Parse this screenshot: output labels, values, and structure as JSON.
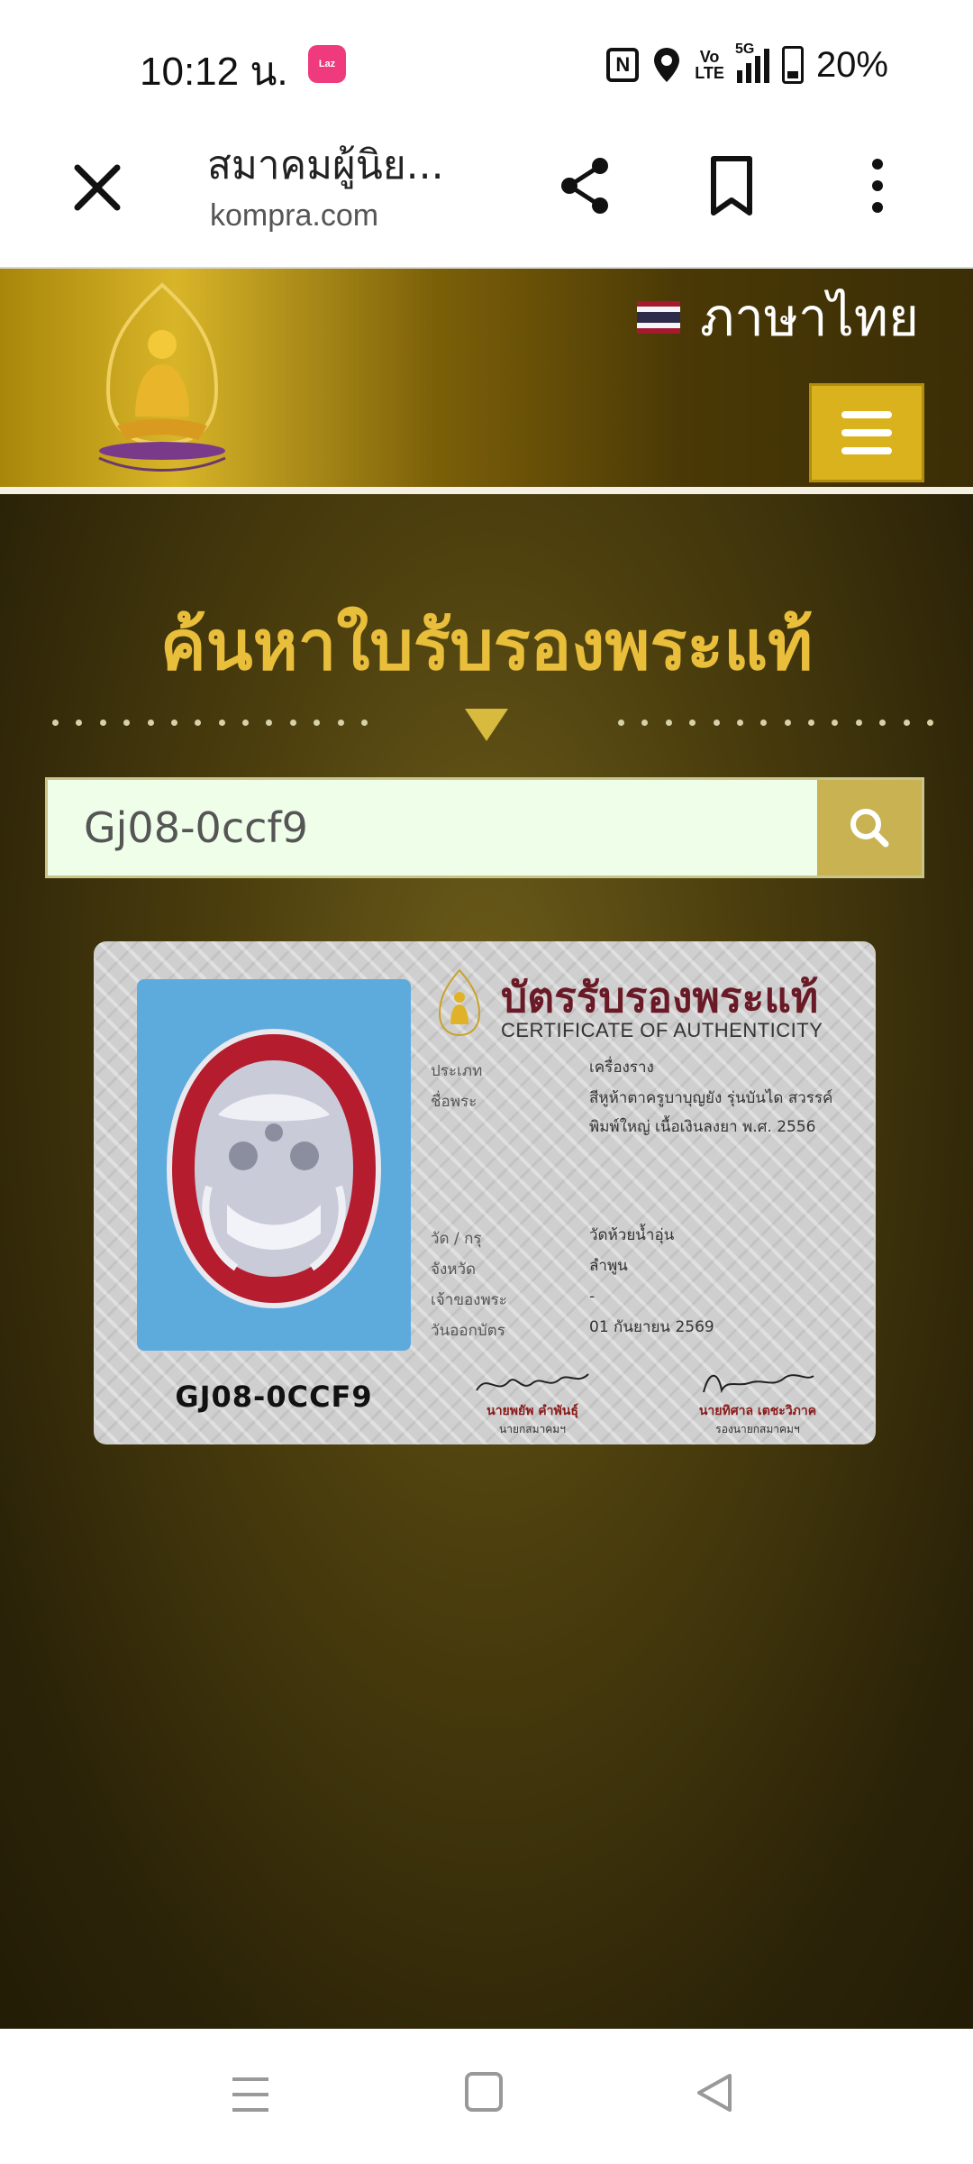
{
  "status_bar": {
    "time": "10:12 น.",
    "laz_label": "Laz",
    "nfc_label": "N",
    "volte_label": "Vo\nLTE",
    "network_label": "5G",
    "battery": "20%"
  },
  "browser": {
    "title": "สมาคมผู้นิย...",
    "url": "kompra.com",
    "icons": [
      "close-icon",
      "share-icon",
      "bookmark-icon",
      "more-vert-icon"
    ]
  },
  "site_header": {
    "language_label": "ภาษาไทย",
    "flag_colors": [
      "#A51931",
      "#F4F5F8",
      "#2D2A4A",
      "#F4F5F8",
      "#A51931"
    ],
    "menu_icon": "hamburger-icon"
  },
  "search": {
    "heading": "ค้นหาใบรับรองพระแท้",
    "query": "Gj08-0ccf9",
    "button_icon": "search-icon"
  },
  "certificate": {
    "title_th": "บัตรรับรองพระแท้",
    "title_en": "CERTIFICATE OF AUTHENTICITY",
    "code": "GJ08-0CCF9",
    "fields": [
      {
        "label": "ประเภท",
        "value": "เครื่องราง"
      },
      {
        "label": "ชื่อพระ",
        "value": "สีหูห้าตาครูบาบุญยัง รุ่นบันได สวรรค์ พิมพ์ใหญ่ เนื้อเงินลงยา พ.ศ. 2556"
      },
      {
        "label": "วัด / กรุ",
        "value": "วัดห้วยน้ำอุ่น"
      },
      {
        "label": "จังหวัด",
        "value": "ลำพูน"
      },
      {
        "label": "เจ้าของพระ",
        "value": "-"
      },
      {
        "label": "วันออกบัตร",
        "value": "01 กันยายน 2569"
      }
    ],
    "signatures": [
      {
        "name": "นายพยัพ คำพันธุ์",
        "role": "นายกสมาคมฯ"
      },
      {
        "name": "นายทิศาล เตชะวิภาค",
        "role": "รองนายกสมาคมฯ"
      }
    ]
  },
  "nav_bar": {
    "icons": [
      "recents-icon",
      "home-icon",
      "back-icon"
    ]
  }
}
